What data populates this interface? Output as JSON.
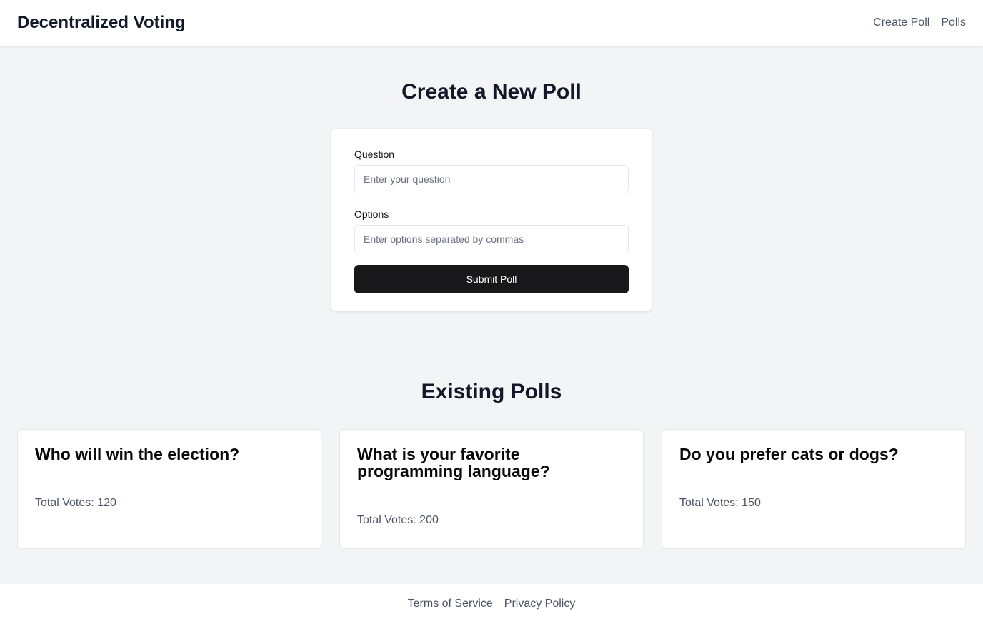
{
  "header": {
    "title": "Decentralized Voting",
    "nav": [
      "Create Poll",
      "Polls"
    ]
  },
  "create": {
    "heading": "Create a New Poll",
    "question_label": "Question",
    "question_placeholder": "Enter your question",
    "question_value": "",
    "options_label": "Options",
    "options_placeholder": "Enter options separated by commas",
    "options_value": "",
    "submit_label": "Submit Poll"
  },
  "existing": {
    "heading": "Existing Polls",
    "polls": [
      {
        "question": "Who will win the election?",
        "votes": "Total Votes: 120"
      },
      {
        "question": "What is your favorite programming language?",
        "votes": "Total Votes: 200"
      },
      {
        "question": "Do you prefer cats or dogs?",
        "votes": "Total Votes: 150"
      }
    ]
  },
  "footer": {
    "links": [
      "Terms of Service",
      "Privacy Policy"
    ]
  }
}
